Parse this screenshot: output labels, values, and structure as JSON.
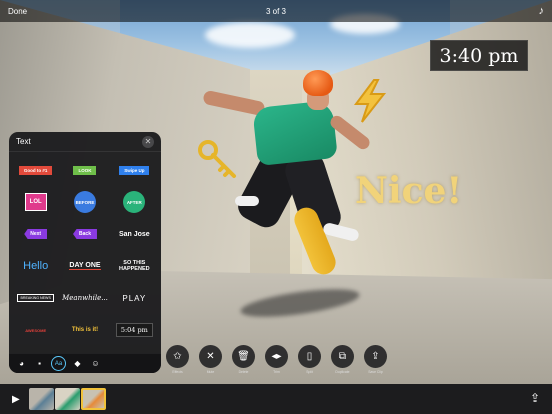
{
  "topbar": {
    "done_label": "Done",
    "title": "3 of 3",
    "music_icon": "music-note-icon"
  },
  "stickers": {
    "time": "3:40 pm",
    "nice": "Nice!",
    "bolt_icon": "lightning-bolt-sticker",
    "key_icon": "key-sticker",
    "yellow": "#f1d37a"
  },
  "text_panel": {
    "title": "Text",
    "close_icon": "close-icon",
    "items": [
      {
        "text": "Good to #1",
        "style": "tag",
        "fg": "#fff",
        "bg": "#e24a3b"
      },
      {
        "text": "LOOK",
        "style": "tag",
        "fg": "#fff",
        "bg": "#6fbf4a"
      },
      {
        "text": "Swipe Up",
        "style": "tag",
        "fg": "#fff",
        "bg": "#2f80ed"
      },
      {
        "text": "LOL",
        "style": "badge",
        "fg": "#fff",
        "bg": "#e03a8c"
      },
      {
        "text": "BEFORE",
        "style": "circle",
        "fg": "#fff",
        "bg": "#3a7be0"
      },
      {
        "text": "AFTER",
        "style": "circle",
        "fg": "#fff",
        "bg": "#2ab37a"
      },
      {
        "text": "Next",
        "style": "arrow",
        "fg": "#fff",
        "bg": "#8a3ae0"
      },
      {
        "text": "Back",
        "style": "arrow",
        "fg": "#fff",
        "bg": "#8a3ae0"
      },
      {
        "text": "San Jose",
        "style": "plain-bold",
        "fg": "#fff",
        "bg": ""
      },
      {
        "text": "Hello",
        "style": "hello",
        "fg": "#4fb3ff",
        "bg": ""
      },
      {
        "text": "DAY ONE",
        "style": "underline",
        "fg": "#fff",
        "bg": ""
      },
      {
        "text": "SO THIS HAPPENED",
        "style": "stack",
        "fg": "#fff",
        "bg": ""
      },
      {
        "text": "BREAKING NEWS",
        "style": "outline",
        "fg": "#fff",
        "bg": ""
      },
      {
        "text": "Meanwhile...",
        "style": "script",
        "fg": "#fff",
        "bg": ""
      },
      {
        "text": "PLAY",
        "style": "wide",
        "fg": "#fff",
        "bg": ""
      },
      {
        "text": "AWESOME",
        "style": "tiny-red",
        "fg": "#e2403a",
        "bg": ""
      },
      {
        "text": "This is it!",
        "style": "yellow",
        "fg": "#f2c23a",
        "bg": ""
      },
      {
        "text": "5:04 pm",
        "style": "clock",
        "fg": "#fff",
        "bg": "#1a1a1a"
      }
    ],
    "style_bar": [
      {
        "icon": "color-wheel-icon",
        "glyph": "◕",
        "active": false
      },
      {
        "icon": "speech-bubble-icon",
        "glyph": "▪",
        "active": false
      },
      {
        "icon": "text-style-icon",
        "glyph": "Aa",
        "active": true
      },
      {
        "icon": "label-sticker-icon",
        "glyph": "◆",
        "active": false
      },
      {
        "icon": "emoji-icon",
        "glyph": "☺",
        "active": false
      }
    ],
    "accent": "#5ac8fa"
  },
  "tools": [
    {
      "name": "effects-button",
      "icon": "star-effects-icon",
      "glyph": "✩",
      "label": "Effects"
    },
    {
      "name": "mute-button",
      "icon": "mute-icon",
      "glyph": "✕",
      "label": "Mute"
    },
    {
      "name": "delete-button",
      "icon": "trash-icon",
      "glyph": "🗑",
      "label": "Delete"
    },
    {
      "name": "trim-button",
      "icon": "trim-icon",
      "glyph": "◂▸",
      "label": "Trim"
    },
    {
      "name": "split-button",
      "icon": "split-icon",
      "glyph": "▯",
      "label": "Split"
    },
    {
      "name": "duplicate-button",
      "icon": "duplicate-icon",
      "glyph": "⧉",
      "label": "Duplicate"
    },
    {
      "name": "save-clip-button",
      "icon": "save-clip-icon",
      "glyph": "⇪",
      "label": "Save Clip"
    }
  ],
  "filmstrip": {
    "play_icon": "play-icon",
    "share_icon": "share-icon",
    "clips": [
      {
        "name": "clip-1",
        "colors": [
          "#b9b4aa",
          "#5b7f96"
        ]
      },
      {
        "name": "clip-2",
        "colors": [
          "#d9d3c4",
          "#2a9d6e"
        ]
      },
      {
        "name": "clip-3",
        "colors": [
          "#c8c2b3",
          "#e68a3a"
        ],
        "selected": true
      }
    ]
  }
}
